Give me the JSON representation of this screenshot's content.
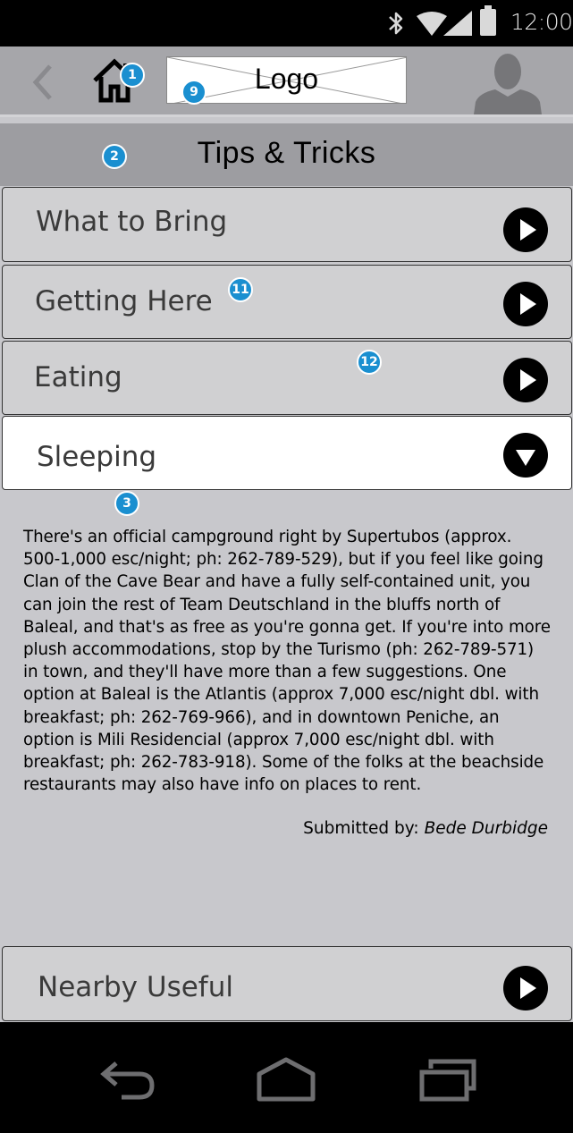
{
  "status_bar": {
    "time": "12:00"
  },
  "app_bar": {
    "logo_text": "Logo"
  },
  "section": {
    "title": "Tips & Tricks"
  },
  "accordion": [
    {
      "label": "What to Bring",
      "expanded": false
    },
    {
      "label": "Getting Here",
      "expanded": false
    },
    {
      "label": "Eating",
      "expanded": false
    },
    {
      "label": "Sleeping",
      "expanded": true
    },
    {
      "label": "Nearby Useful",
      "expanded": false
    }
  ],
  "content": {
    "paragraph_lines": [
      "There's an official campground right by Supertubos (approx.",
      "500-1,000 esc/night; ph: 262-789-529), but if you feel like going",
      "Clan of the Cave Bear and have a fully self-contained unit, you",
      "can join the rest of Team Deutschland in the bluffs north of",
      "Baleal, and that's as free as you're gonna get. If you're into more",
      "plush accommodations, stop by the Turismo (ph: 262-789-571)",
      "in town, and they'll have more than a few suggestions. One",
      "option at Baleal is the Atlantis (approx 7,000 esc/night dbl. with",
      "breakfast; ph: 262-769-966), and in downtown Peniche, an",
      "option is Mili Residencial (approx 7,000 esc/night dbl. with",
      "breakfast; ph: 262-783-918). Some of the folks at the beachside",
      "restaurants may also have info on places to rent."
    ],
    "submitted_label": "Submitted by:",
    "submitted_author": "Bede Durbidge"
  },
  "annotations": [
    "1",
    "9",
    "2",
    "11",
    "12",
    "3"
  ],
  "colors": {
    "badge": "#1a8fd0",
    "app_bar": "#a6a6aa",
    "section_header": "#9d9da1",
    "row": "#d0d0d2"
  }
}
